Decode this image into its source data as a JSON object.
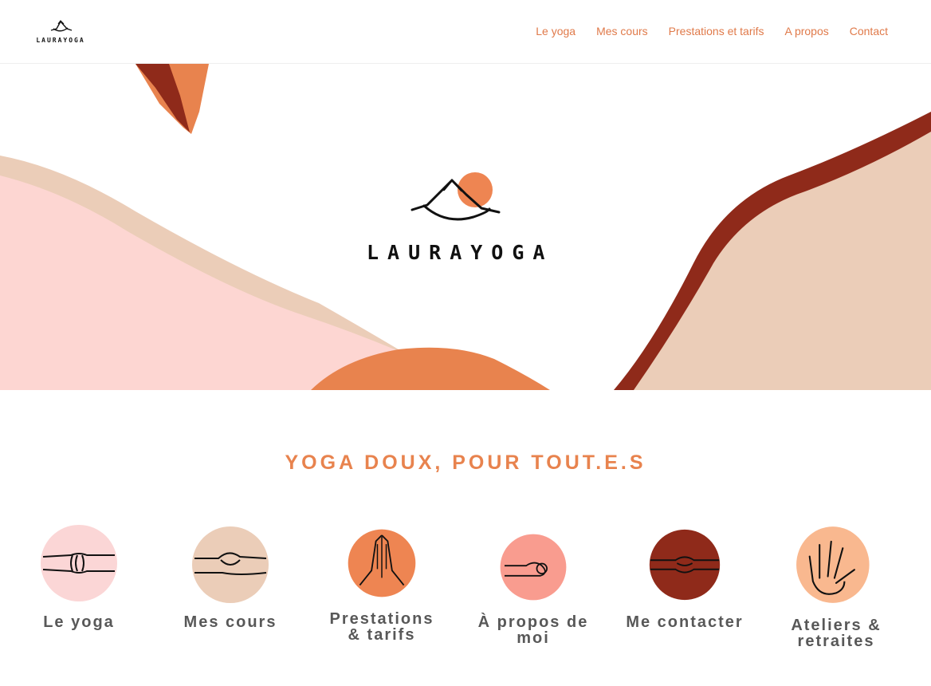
{
  "header": {
    "logo_text": "LAURAYOGA",
    "nav": [
      {
        "label": "Le yoga"
      },
      {
        "label": "Mes cours"
      },
      {
        "label": "Prestations et tarifs"
      },
      {
        "label": "A propos"
      },
      {
        "label": "Contact"
      }
    ]
  },
  "hero": {
    "brand": "LAURAYOGA"
  },
  "main": {
    "tagline": "YOGA DOUX, POUR TOUT.E.S",
    "cards": [
      {
        "label": "Le yoga",
        "icon": "fist-hands-icon",
        "color": "#fbd6d6"
      },
      {
        "label": "Mes cours",
        "icon": "mudra-hand-icon",
        "color": "#ebcdb8"
      },
      {
        "label": "Prestations & tarifs",
        "icon": "praying-hands-icon",
        "color": "#ee8552"
      },
      {
        "label": "À propos de moi",
        "icon": "gyan-mudra-icon",
        "color": "#f99c8f"
      },
      {
        "label": "Me contacter",
        "icon": "cupped-hands-icon",
        "color": "#8f2a1a"
      },
      {
        "label": "Ateliers & retraites",
        "icon": "open-hand-icon",
        "color": "#f9b88f"
      }
    ]
  },
  "colors": {
    "accent": "#e8834e",
    "pink": "#fdd6d2",
    "beige": "#ebcdb8",
    "rust": "#8f2a1a",
    "orange": "#e8834e"
  }
}
